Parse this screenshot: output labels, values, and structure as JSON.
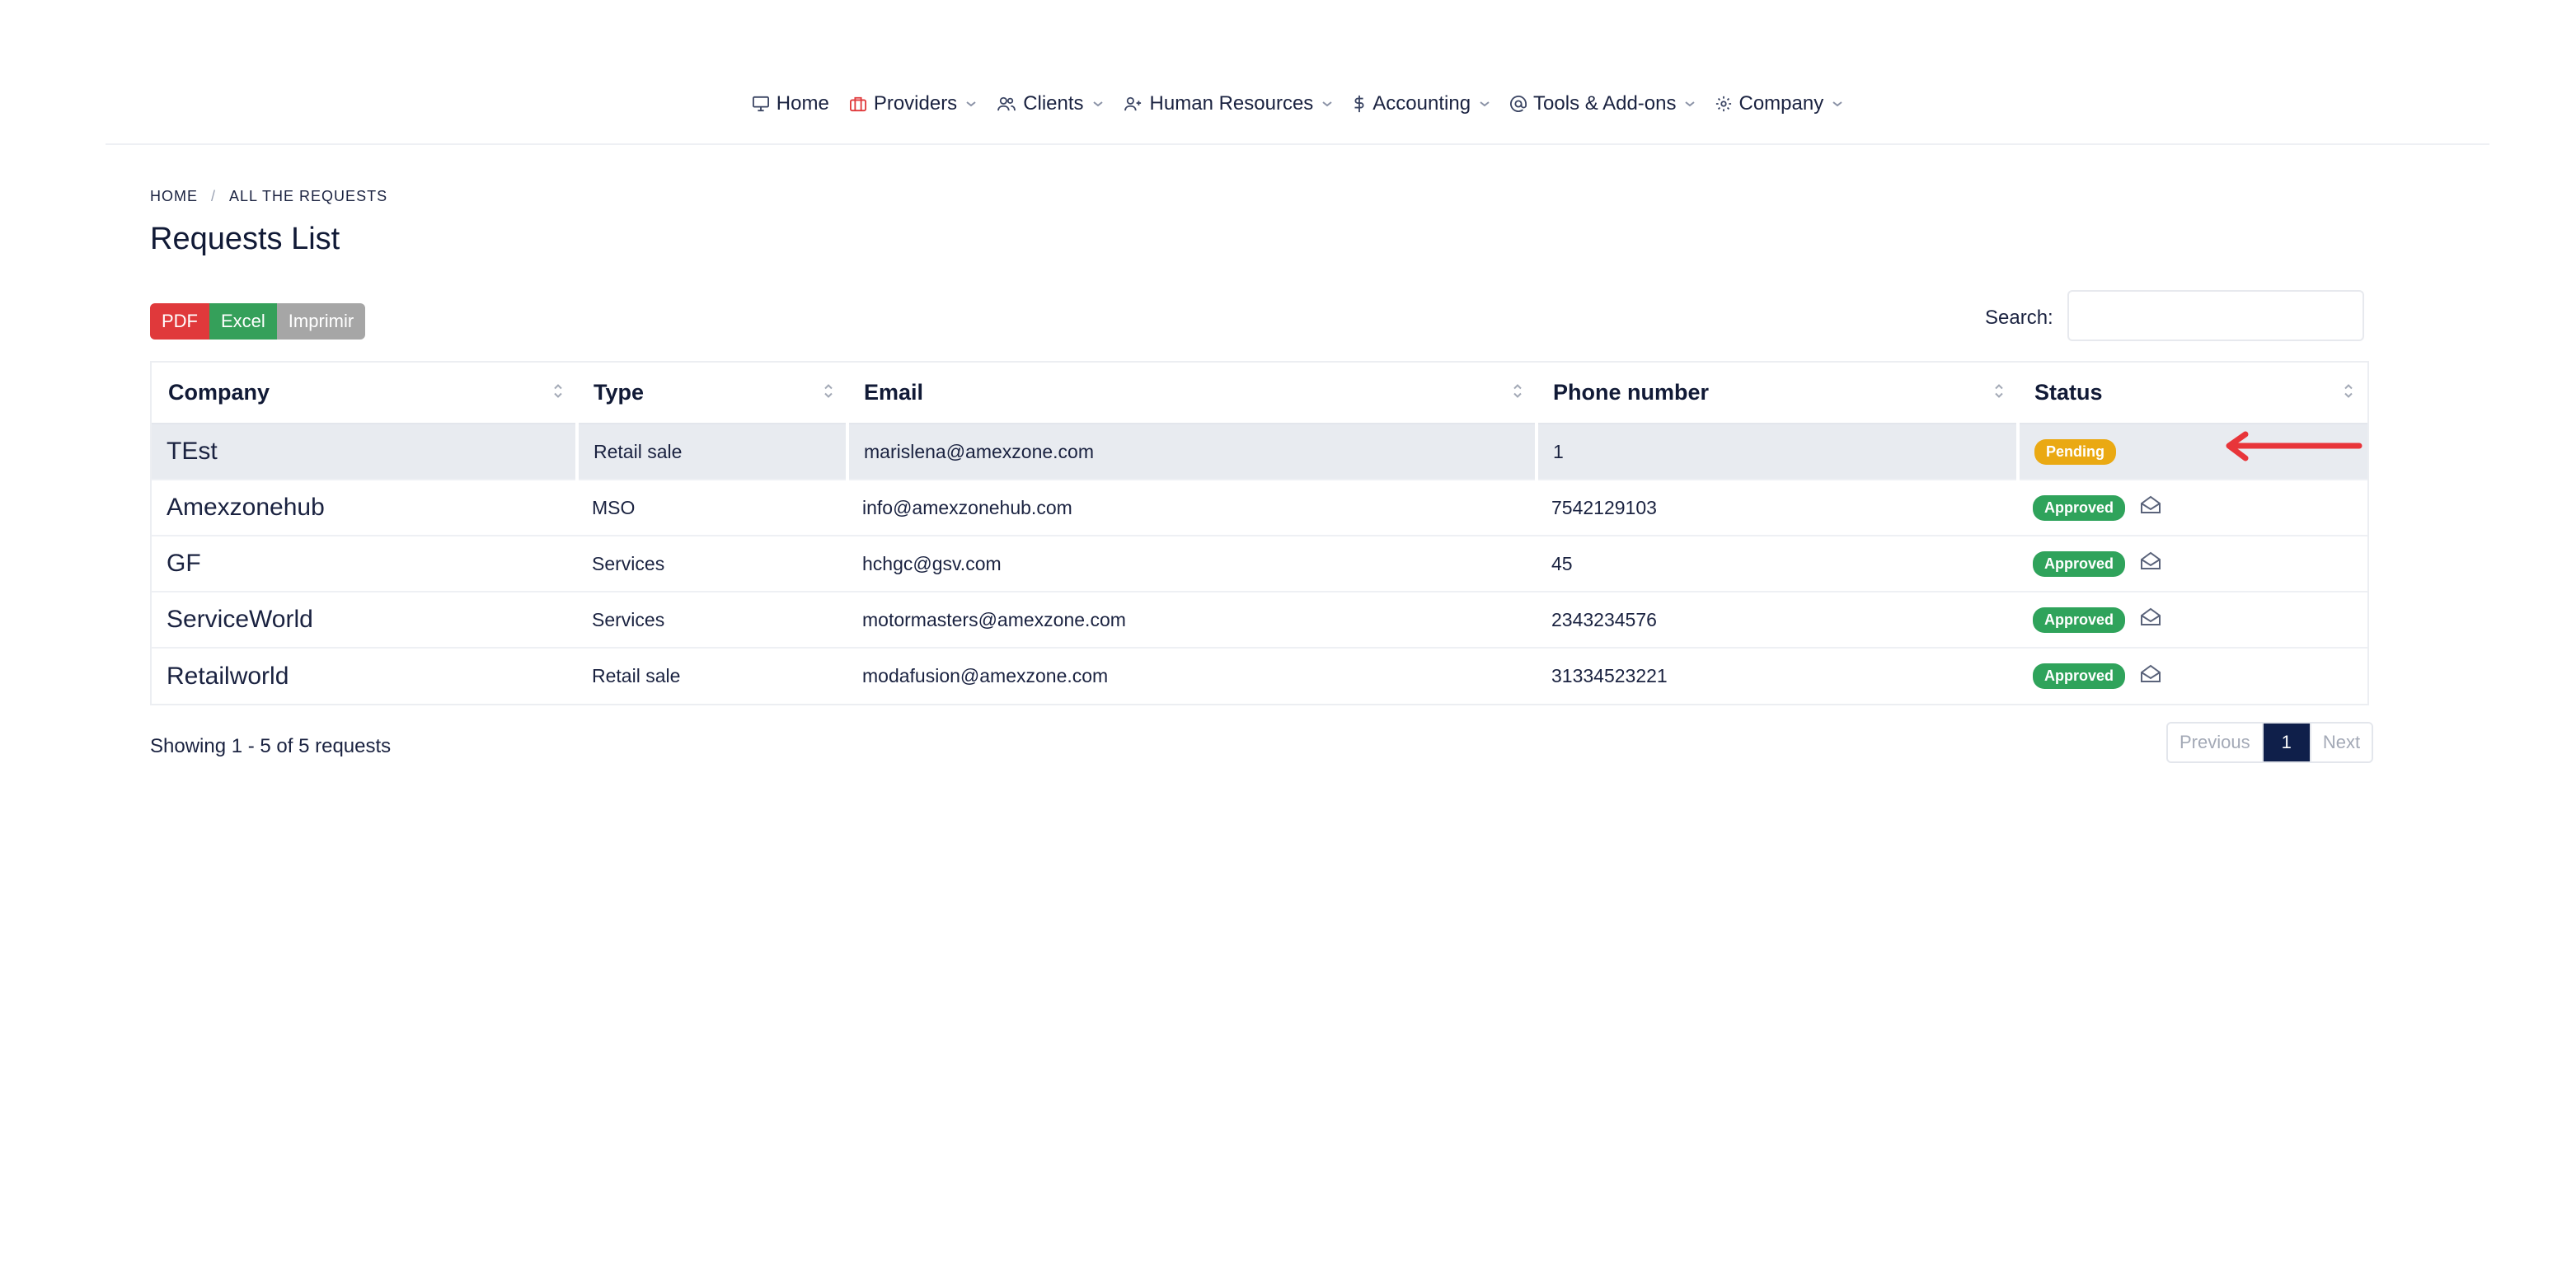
{
  "nav": {
    "items": [
      {
        "label": "Home",
        "icon": "monitor-icon"
      },
      {
        "label": "Providers",
        "icon": "briefcase-icon"
      },
      {
        "label": "Clients",
        "icon": "users-icon"
      },
      {
        "label": "Human Resources",
        "icon": "user-plus-icon"
      },
      {
        "label": "Accounting",
        "icon": "dollar-icon"
      },
      {
        "label": "Tools & Add-ons",
        "icon": "at-icon"
      },
      {
        "label": "Company",
        "icon": "gear-icon"
      }
    ]
  },
  "breadcrumb": {
    "home": "HOME",
    "separator": "/",
    "current": "ALL THE REQUESTS"
  },
  "page": {
    "title": "Requests List"
  },
  "export": {
    "pdf": "PDF",
    "excel": "Excel",
    "print": "Imprimir"
  },
  "search": {
    "label": "Search:",
    "value": "",
    "placeholder": ""
  },
  "table": {
    "columns": [
      "Company",
      "Type",
      "Email",
      "Phone number",
      "Status"
    ],
    "rows": [
      {
        "company": "TEst",
        "type": "Retail sale",
        "email": "marislena@amexzone.com",
        "phone": "1",
        "status": "Pending"
      },
      {
        "company": "Amexzonehub",
        "type": "MSO",
        "email": "info@amexzonehub.com",
        "phone": "7542129103",
        "status": "Approved"
      },
      {
        "company": "GF",
        "type": "Services",
        "email": "hchgc@gsv.com",
        "phone": "45",
        "status": "Approved"
      },
      {
        "company": "ServiceWorld",
        "type": "Services",
        "email": "motormasters@amexzone.com",
        "phone": "2343234576",
        "status": "Approved"
      },
      {
        "company": "Retailworld",
        "type": "Retail sale",
        "email": "modafusion@amexzone.com",
        "phone": "31334523221",
        "status": "Approved"
      }
    ]
  },
  "footer": {
    "showing": "Showing 1 - 5 of 5 requests",
    "previous": "Previous",
    "current_page": "1",
    "next": "Next"
  },
  "colors": {
    "pdf": "#e0393b",
    "excel": "#35a05a",
    "print": "#a6a6a6",
    "pending": "#eaa913",
    "approved": "#2fa35b",
    "arrow": "#e8353a",
    "active_page": "#0f1f4a",
    "providers_icon": "#e0393b"
  }
}
